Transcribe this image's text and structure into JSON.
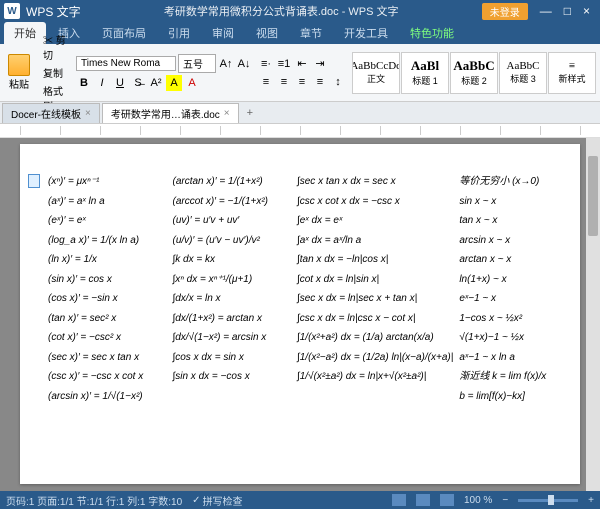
{
  "app": {
    "name": "WPS 文字",
    "doc_title": "考研数学常用微积分公式背诵表.doc - WPS 文字"
  },
  "titlebar": {
    "login": "未登录",
    "min": "—",
    "max": "□",
    "close": "×"
  },
  "menu": {
    "tabs": [
      "开始",
      "插入",
      "页面布局",
      "引用",
      "审阅",
      "视图",
      "章节",
      "开发工具"
    ],
    "special": "特色功能"
  },
  "ribbon": {
    "paste": "粘贴",
    "cut": "剪切",
    "copy": "复制",
    "format_painter": "格式刷",
    "font": "Times New Roma",
    "size": "五号",
    "styles": [
      {
        "preview": "AaBbCcDd",
        "label": "正文"
      },
      {
        "preview": "AaBl",
        "label": "标题 1"
      },
      {
        "preview": "AaBbC",
        "label": "标题 2"
      },
      {
        "preview": "AaBbC",
        "label": "标题 3"
      },
      {
        "preview": "≡",
        "label": "新样式"
      }
    ]
  },
  "doctabs": {
    "tab1": "Docer-在线模板",
    "tab2": "考研数学常用…诵表.doc"
  },
  "formulas": {
    "col1": [
      "(xⁿ)′ = μxⁿ⁻¹",
      "(aˣ)′ = aˣ ln a",
      "(eˣ)′ = eˣ",
      "(log_a x)′ = 1/(x ln a)",
      "(ln x)′ = 1/x",
      "(sin x)′ = cos x",
      "(cos x)′ = −sin x",
      "(tan x)′ = sec² x",
      "(cot x)′ = −csc² x",
      "(sec x)′ = sec x tan x",
      "(csc x)′ = −csc x cot x",
      "(arcsin x)′ = 1/√(1−x²)"
    ],
    "col2": [
      "(arctan x)′ = 1/(1+x²)",
      "(arccot x)′ = −1/(1+x²)",
      "(uv)′ = u′v + uv′",
      "(u/v)′ = (u′v − uv′)/v²",
      "∫k dx = kx",
      "∫xⁿ dx = xⁿ⁺¹/(μ+1)",
      "∫dx/x = ln x",
      "∫dx/(1+x²) = arctan x",
      "∫dx/√(1−x²) = arcsin x",
      "∫cos x dx = sin x",
      "∫sin x dx = −cos x"
    ],
    "col3": [
      "∫sec x tan x dx = sec x",
      "∫csc x cot x dx = −csc x",
      "∫eˣ dx = eˣ",
      "∫aˣ dx = aˣ/ln a",
      "∫tan x dx = −ln|cos x|",
      "∫cot x dx = ln|sin x|",
      "∫sec x dx = ln|sec x + tan x|",
      "∫csc x dx = ln|csc x − cot x|",
      "∫1/(x²+a²) dx = (1/a) arctan(x/a)",
      "∫1/(x²−a²) dx = (1/2a) ln|(x−a)/(x+a)|",
      "∫1/√(x²±a²) dx = ln|x+√(x²±a²)|"
    ],
    "col4": [
      "等价无穷小 (x→0)",
      "sin x ~ x",
      "tan x ~ x",
      "arcsin x ~ x",
      "arctan x ~ x",
      "ln(1+x) ~ x",
      "eˣ−1 ~ x",
      "1−cos x ~ ½x²",
      "√(1+x)−1 ~ ½x",
      "aˣ−1 ~ x ln a",
      "渐近线 k = lim f(x)/x",
      "b = lim[f(x)−kx]"
    ]
  },
  "status": {
    "page": "页码:1  页面:1/1  节:1/1  行:1  列:1  字数:10",
    "spell": "拼写检查",
    "zoom": "100 %"
  }
}
